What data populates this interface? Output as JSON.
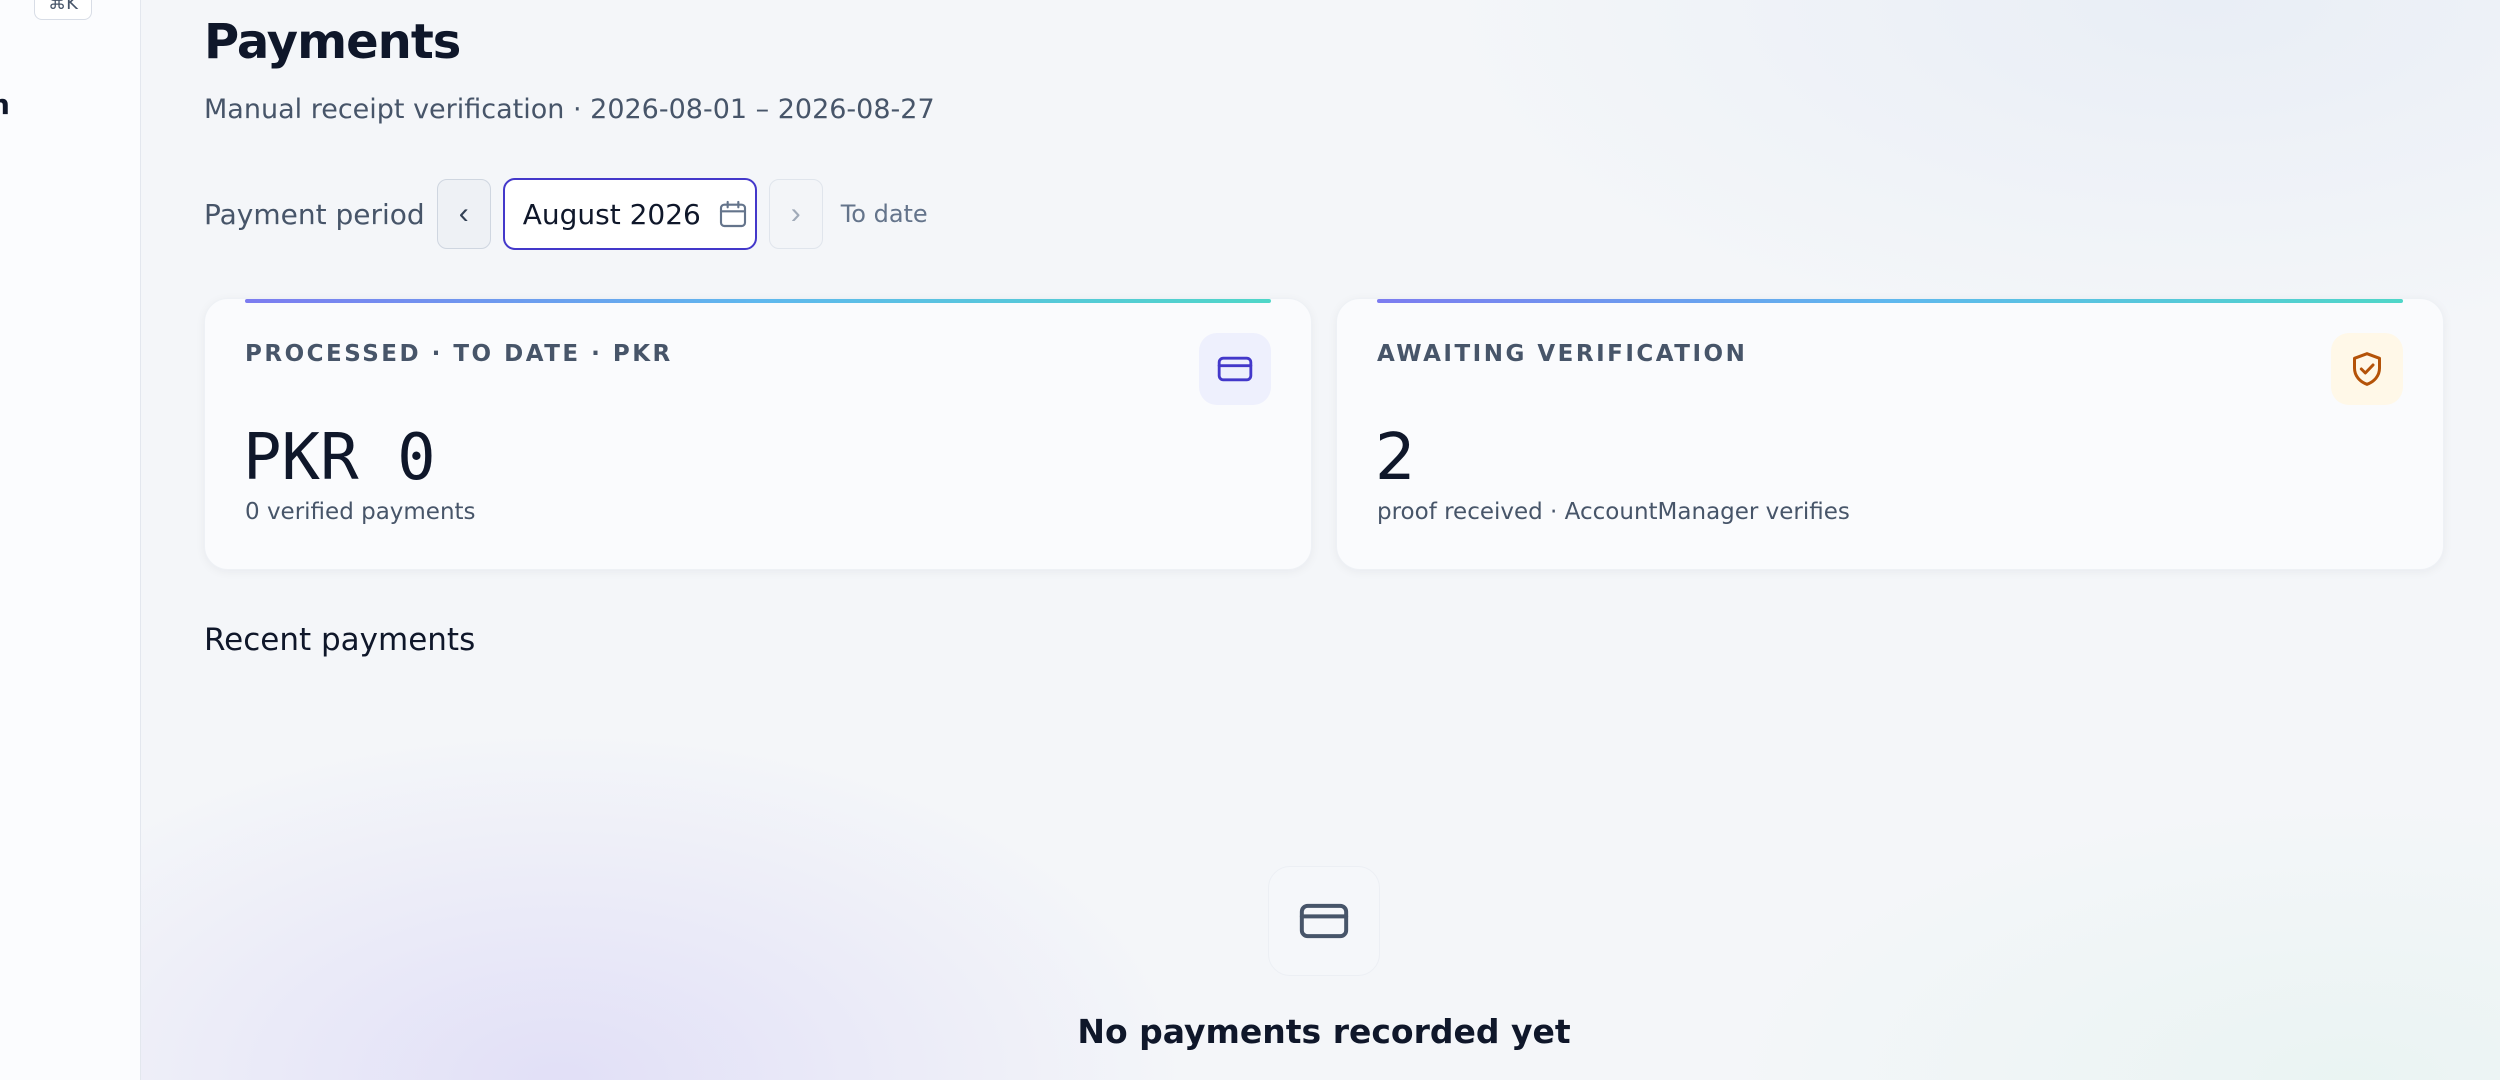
{
  "sidebar": {
    "shortcut_hint": "⌘K",
    "truncated_label": "n"
  },
  "header": {
    "title": "Payments",
    "subtitle": "Manual receipt verification · 2026-08-01 – 2026-08-27"
  },
  "period": {
    "label": "Payment period",
    "prev_glyph": "‹",
    "selected_month": "August 2026",
    "next_glyph": "›",
    "to_date_label": "To date"
  },
  "cards": {
    "processed": {
      "label": "PROCESSED · TO DATE · PKR",
      "value": "PKR 0",
      "note": "0 verified payments",
      "icon": "credit-card-icon",
      "accent": "#4338ca"
    },
    "awaiting": {
      "label": "AWAITING VERIFICATION",
      "value": "2",
      "note": "proof received · AccountManager verifies",
      "icon": "shield-check-icon",
      "accent": "#b45309"
    }
  },
  "recent": {
    "title": "Recent payments",
    "empty_icon": "credit-card-icon",
    "empty_message": "No payments recorded yet"
  }
}
